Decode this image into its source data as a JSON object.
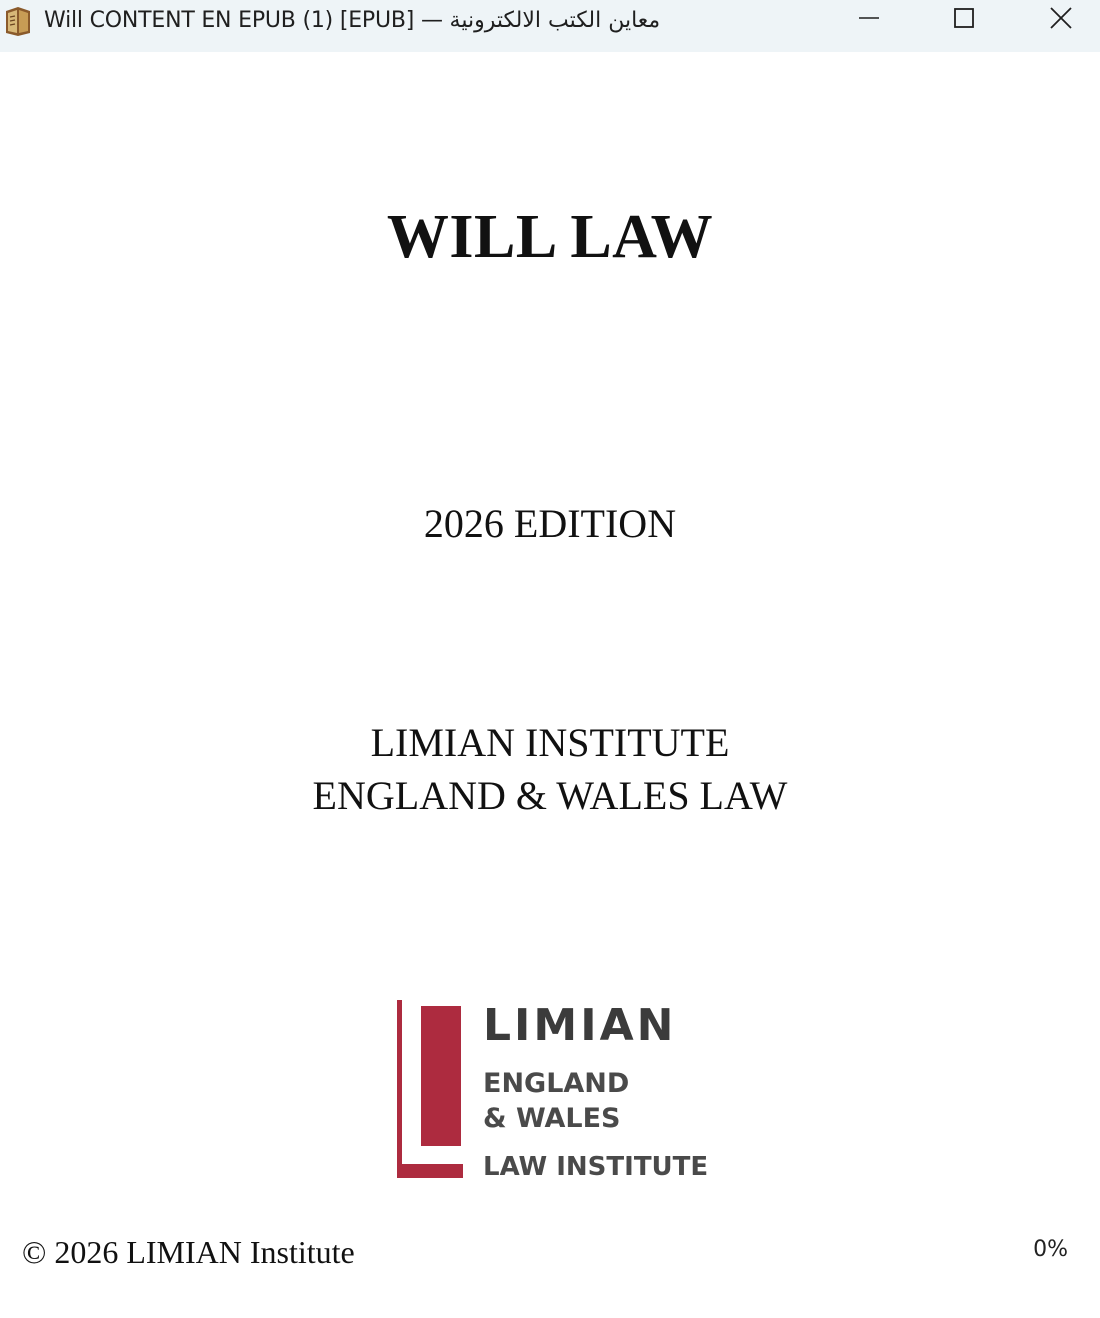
{
  "window": {
    "title": "Will CONTENT EN EPUB (1) [EPUB] — معاين الكتب الالكترونية",
    "controls": {
      "minimize": "minimize-icon",
      "maximize": "maximize-icon",
      "close": "close-icon"
    }
  },
  "book": {
    "title": "WILL LAW",
    "edition": "2026 EDITION",
    "publisher_lines": [
      "LIMIAN INSTITUTE",
      "ENGLAND & WALES LAW"
    ],
    "logo": {
      "name": "LIMIAN",
      "region_lines": [
        "ENGLAND",
        "& WALES"
      ],
      "subtitle": "LAW INSTITUTE",
      "accent_color": "#ad2b3f"
    },
    "copyright": "© 2026 LIMIAN Institute"
  },
  "status": {
    "progress": "0%"
  }
}
